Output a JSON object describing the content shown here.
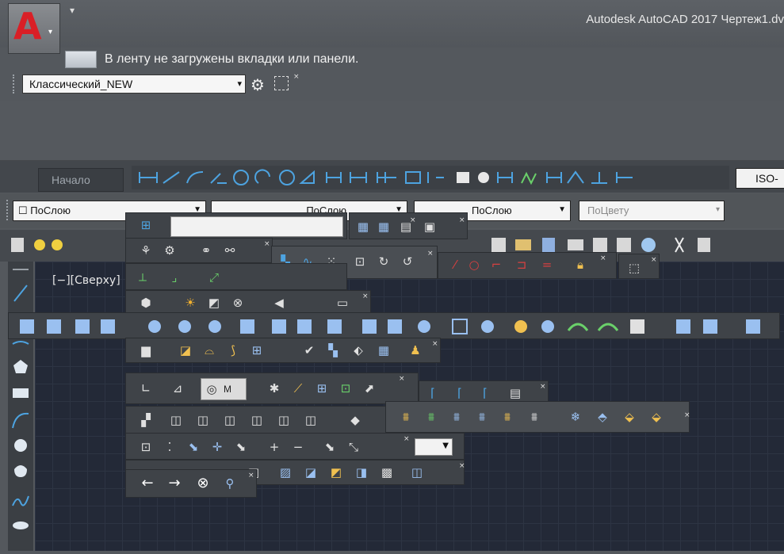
{
  "title": "Autodesk AutoCAD 2017    Чертеж1.dv",
  "app_button": {
    "letter": "A",
    "caret": "▾"
  },
  "qat_caret": "▾",
  "ribbon_message": "В ленту не загружены вкладки или панели.",
  "workspace": {
    "value": "Классический_NEW",
    "arrow": "▾"
  },
  "tabs": {
    "start": "Начало"
  },
  "dim_style": "ISO-",
  "properties": {
    "layer": "ПоСлою",
    "linetype": "ПоСлою",
    "lineweight": "ПоСлою",
    "plotstyle": "ПоЦвету"
  },
  "viewport_label": "[−][Сверху]",
  "nav_small_label": "М",
  "icons": {
    "gear": "gear-icon",
    "close": "×",
    "arrow_left": "←",
    "arrow_right": "→",
    "stop": "⊗"
  },
  "colors": {
    "app_red": "#d91f26",
    "canvas": "#232937",
    "toolbar_dark": "#3f4348"
  }
}
